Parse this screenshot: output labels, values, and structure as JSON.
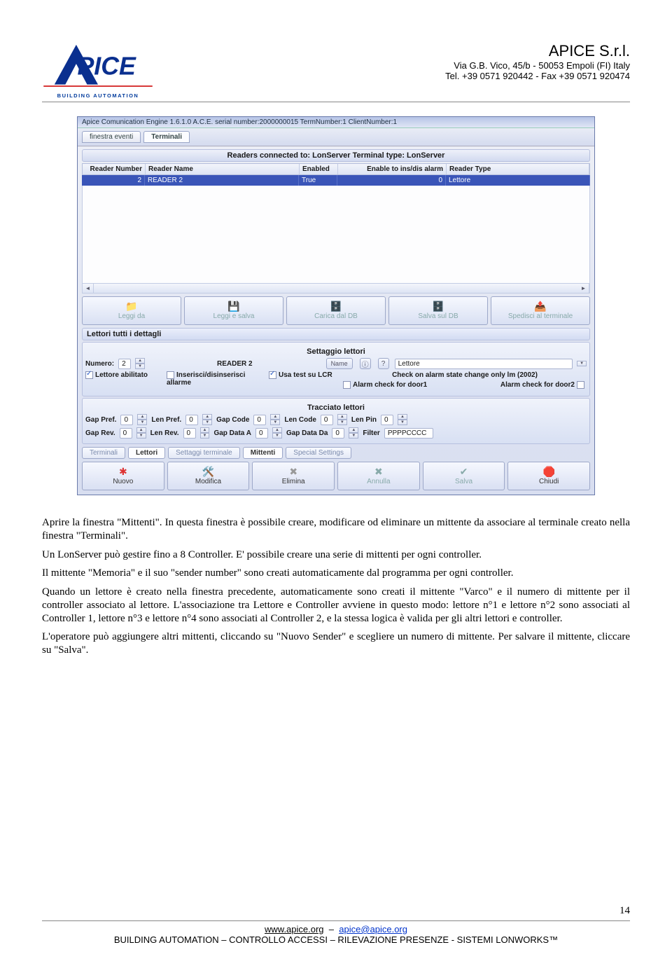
{
  "header": {
    "company": "APICE S.r.l.",
    "address": "Via G.B. Vico, 45/b - 50053 Empoli (FI) Italy",
    "tel": "Tel. +39 0571 920442 - Fax +39 0571 920474",
    "logo_caption": "BUILDING AUTOMATION"
  },
  "app": {
    "titlebar": "Apice Comunication Engine 1.6.1.0 A.C.E. serial number:2000000015 TermNumber:1 ClientNumber:1",
    "tabs": {
      "t1": "finestra eventi",
      "t2": "Terminali"
    },
    "readers_header": "Readers connected to: LonServer Terminal type: LonServer",
    "cols": {
      "num": "Reader Number",
      "name": "Reader Name",
      "en": "Enabled",
      "alarm": "Enable to ins/dis alarm",
      "type": "Reader Type"
    },
    "row": {
      "num": "2",
      "name": "READER 2",
      "en": "True",
      "alarm": "0",
      "type": "Lettore"
    },
    "btns1": {
      "b1": "Leggi da",
      "b2": "Leggi e salva",
      "b3": "Carica dal DB",
      "b4": "Salva sul DB",
      "b5": "Spedisci al terminale"
    },
    "dettagli": "Lettori tutti i dettagli",
    "settaggio": "Settaggio lettori",
    "form": {
      "numero_lbl": "Numero:",
      "numero": "2",
      "reader2": "READER 2",
      "name_btn": "Name",
      "lettore_dd": "Lettore",
      "lettore_abil": "Lettore abilitato",
      "ins_dis": "Inserisci/disinserisci allarme",
      "usa_test": "Usa test su LCR",
      "check_alarm": "Check on alarm state change only  lm (2002)",
      "alarm_d1": "Alarm check for door1",
      "alarm_d2": "Alarm check for door2"
    },
    "tracciato": "Tracciato lettori",
    "trac": {
      "gap_pref": "Gap Pref.",
      "len_pref": "Len Pref.",
      "gap_code": "Gap Code",
      "len_code": "Len Code",
      "len_pin": "Len Pin",
      "gap_rev": "Gap Rev.",
      "len_rev": "Len Rev.",
      "gap_da_a": "Gap Data A",
      "gap_da_da": "Gap Data Da",
      "filter_lbl": "Filter",
      "zero": "0",
      "filter": "PPPPCCCC"
    },
    "nav": {
      "t1": "Terminali",
      "t2": "Lettori",
      "t3": "Settaggi terminale",
      "t4": "Mittenti",
      "t5": "Special Settings"
    },
    "btns2": {
      "nuovo": "Nuovo",
      "modifica": "Modifica",
      "elimina": "Elimina",
      "annulla": "Annulla",
      "salva": "Salva",
      "chiudi": "Chiudi"
    }
  },
  "text": {
    "p1": "Aprire la finestra \"Mittenti\". In questa finestra è possibile creare, modificare od eliminare un mittente da associare al terminale creato nella finestra \"Terminali\".",
    "p2": "Un LonServer può gestire fino a 8 Controller. E' possibile creare una serie di mittenti per ogni controller.",
    "p3": "Il mittente \"Memoria\" e il suo \"sender number\" sono creati automaticamente dal programma per ogni controller.",
    "p4": "Quando un lettore è creato nella finestra precedente, automaticamente sono creati il mittente \"Varco\" e il numero di mittente per il controller associato al lettore. L'associazione tra Lettore e Controller avviene in questo modo: lettore n°1 e lettore n°2 sono associati al Controller 1, lettore n°3 e lettore n°4 sono associati al Controller 2, e la stessa logica è valida per gli altri lettori e controller.",
    "p5": "L'operatore può aggiungere altri mittenti, cliccando su \"Nuovo Sender\" e scegliere un numero di mittente. Per salvare il mittente, cliccare su \"Salva\"."
  },
  "footer": {
    "www": "www.apice.org",
    "email": "apice@apice.org",
    "line2": "BUILDING AUTOMATION – CONTROLLO ACCESSI – RILEVAZIONE PRESENZE - SISTEMI LONWORKS™",
    "page": "14"
  }
}
